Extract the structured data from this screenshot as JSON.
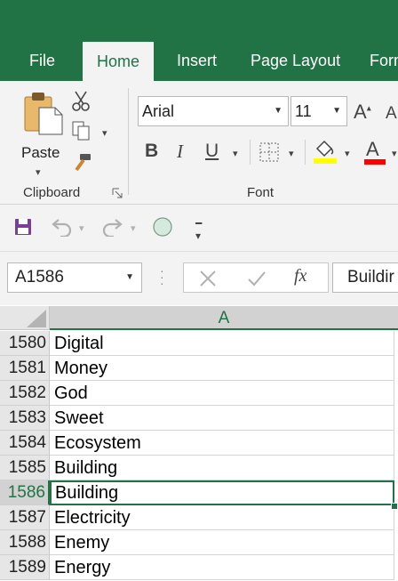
{
  "tabs": [
    {
      "label": "File",
      "active": false
    },
    {
      "label": "Home",
      "active": true
    },
    {
      "label": "Insert",
      "active": false
    },
    {
      "label": "Page Layout",
      "active": false
    },
    {
      "label": "Form",
      "active": false
    }
  ],
  "ribbon": {
    "clipboard": {
      "group_label": "Clipboard",
      "paste_label": "Paste"
    },
    "font": {
      "group_label": "Font",
      "font_name": "Arial",
      "font_size": "11",
      "bold": "B",
      "italic": "I",
      "underline": "U",
      "font_color_letter": "A"
    }
  },
  "colors": {
    "accent": "#217346",
    "highlight": "#ffff00",
    "font_color": "#ff0000"
  },
  "formula_bar": {
    "name_box": "A1586",
    "fx_label": "fx",
    "content": "Buildir"
  },
  "grid": {
    "column_header": "A",
    "selected_row": "1586",
    "rows": [
      {
        "num": "1580",
        "value": "Digital"
      },
      {
        "num": "1581",
        "value": "Money"
      },
      {
        "num": "1582",
        "value": "God"
      },
      {
        "num": "1583",
        "value": "Sweet"
      },
      {
        "num": "1584",
        "value": "Ecosystem"
      },
      {
        "num": "1585",
        "value": "Building"
      },
      {
        "num": "1586",
        "value": "Building"
      },
      {
        "num": "1587",
        "value": "Electricity"
      },
      {
        "num": "1588",
        "value": "Enemy"
      },
      {
        "num": "1589",
        "value": "Energy"
      }
    ]
  }
}
